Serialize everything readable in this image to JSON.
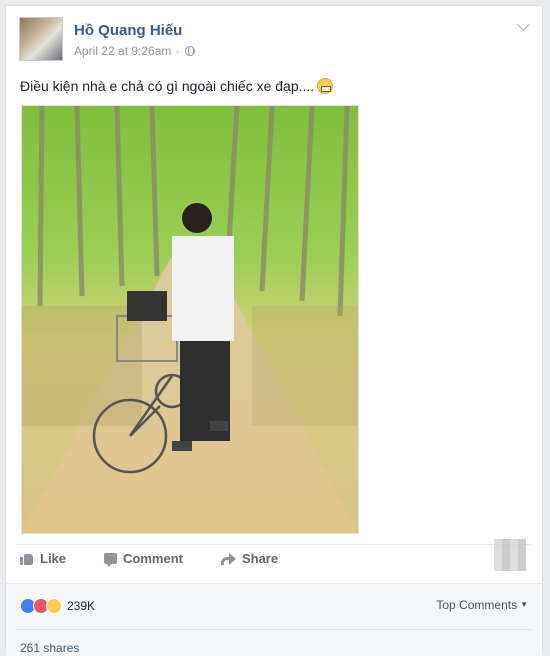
{
  "post": {
    "author": "Hồ Quang Hiếu",
    "timestamp": "April 22 at 9:26am",
    "separator": "·",
    "privacy_icon": "globe-icon",
    "text": "Điều kiện nhà e chả có gì ngoài chiếc xe đạp....",
    "emoji": "grinning-face-emoji"
  },
  "actions": {
    "like_label": "Like",
    "comment_label": "Comment",
    "share_label": "Share"
  },
  "reactions": {
    "types": [
      "like",
      "love",
      "haha"
    ],
    "count": "239K",
    "sort_label": "Top Comments",
    "shares_text": "261 shares"
  },
  "colors": {
    "author_link": "#365899",
    "like": "#4080ff",
    "love": "#f25268",
    "haha": "#ffcc4d"
  }
}
